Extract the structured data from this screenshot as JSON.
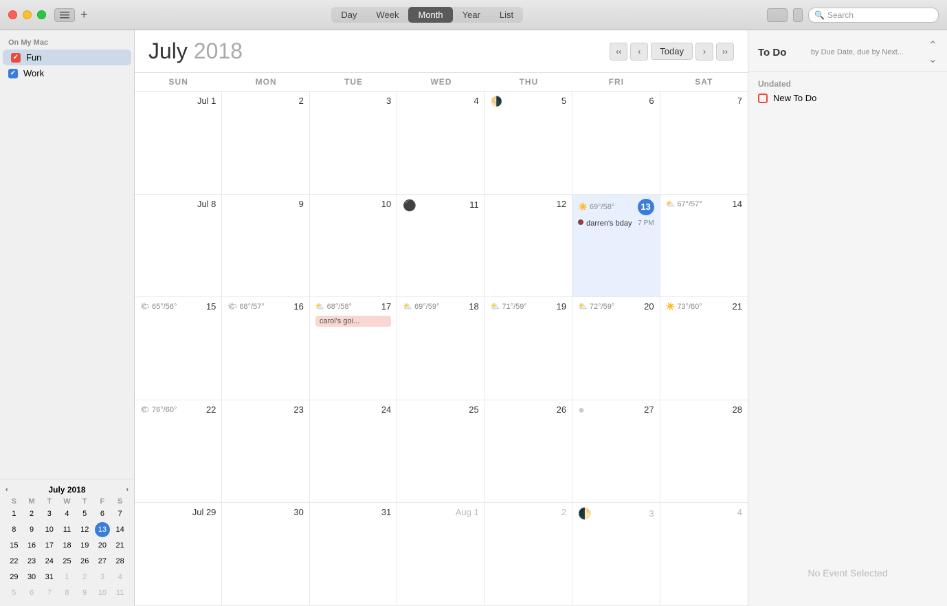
{
  "titlebar": {
    "view_tabs": [
      "Day",
      "Week",
      "Month",
      "Year",
      "List"
    ],
    "active_tab": "Month",
    "search_placeholder": "Search"
  },
  "sidebar": {
    "section_label": "On My Mac",
    "calendars": [
      {
        "name": "Fun",
        "color": "red",
        "checked": true
      },
      {
        "name": "Work",
        "color": "blue",
        "checked": true
      }
    ]
  },
  "mini_cal": {
    "title": "July 2018",
    "day_headers": [
      "S",
      "M",
      "T",
      "W",
      "T",
      "F",
      "S"
    ],
    "weeks": [
      [
        {
          "d": "1",
          "cur": true
        },
        {
          "d": "2",
          "cur": true
        },
        {
          "d": "3",
          "cur": true
        },
        {
          "d": "4",
          "cur": true
        },
        {
          "d": "5",
          "cur": true
        },
        {
          "d": "6",
          "cur": true
        },
        {
          "d": "7",
          "cur": true
        }
      ],
      [
        {
          "d": "8",
          "cur": true
        },
        {
          "d": "9",
          "cur": true
        },
        {
          "d": "10",
          "cur": true
        },
        {
          "d": "11",
          "cur": true
        },
        {
          "d": "12",
          "cur": true
        },
        {
          "d": "13",
          "cur": true,
          "today": true
        },
        {
          "d": "14",
          "cur": true
        }
      ],
      [
        {
          "d": "15",
          "cur": true
        },
        {
          "d": "16",
          "cur": true
        },
        {
          "d": "17",
          "cur": true
        },
        {
          "d": "18",
          "cur": true
        },
        {
          "d": "19",
          "cur": true
        },
        {
          "d": "20",
          "cur": true
        },
        {
          "d": "21",
          "cur": true
        }
      ],
      [
        {
          "d": "22",
          "cur": true
        },
        {
          "d": "23",
          "cur": true
        },
        {
          "d": "24",
          "cur": true
        },
        {
          "d": "25",
          "cur": true
        },
        {
          "d": "26",
          "cur": true
        },
        {
          "d": "27",
          "cur": true
        },
        {
          "d": "28",
          "cur": true
        }
      ],
      [
        {
          "d": "29",
          "cur": true
        },
        {
          "d": "30",
          "cur": true
        },
        {
          "d": "31",
          "cur": true
        },
        {
          "d": "1",
          "cur": false
        },
        {
          "d": "2",
          "cur": false
        },
        {
          "d": "3",
          "cur": false
        },
        {
          "d": "4",
          "cur": false
        }
      ],
      [
        {
          "d": "5",
          "cur": false
        },
        {
          "d": "6",
          "cur": false
        },
        {
          "d": "7",
          "cur": false
        },
        {
          "d": "8",
          "cur": false
        },
        {
          "d": "9",
          "cur": false
        },
        {
          "d": "10",
          "cur": false
        },
        {
          "d": "11",
          "cur": false
        }
      ]
    ]
  },
  "calendar": {
    "title_month": "July",
    "title_year": "2018",
    "day_headers": [
      "SUN",
      "MON",
      "TUE",
      "WED",
      "THU",
      "FRI",
      "SAT"
    ],
    "weeks": [
      {
        "cells": [
          {
            "day": "Jul 1",
            "other": false,
            "weather": null,
            "moon": null,
            "events": []
          },
          {
            "day": "2",
            "other": false,
            "weather": null,
            "moon": null,
            "events": []
          },
          {
            "day": "3",
            "other": false,
            "weather": null,
            "moon": null,
            "events": []
          },
          {
            "day": "4",
            "other": false,
            "weather": null,
            "moon": null,
            "events": []
          },
          {
            "day": "5",
            "other": false,
            "weather": null,
            "moon": "🌗",
            "events": []
          },
          {
            "day": "6",
            "other": false,
            "weather": null,
            "moon": null,
            "events": []
          },
          {
            "day": "7",
            "other": false,
            "weather": null,
            "moon": null,
            "events": []
          }
        ]
      },
      {
        "cells": [
          {
            "day": "Jul 8",
            "other": false,
            "weather": null,
            "moon": null,
            "events": []
          },
          {
            "day": "9",
            "other": false,
            "weather": null,
            "moon": null,
            "events": []
          },
          {
            "day": "10",
            "other": false,
            "weather": null,
            "moon": null,
            "events": []
          },
          {
            "day": "11",
            "other": false,
            "weather": null,
            "moon": null,
            "events": []
          },
          {
            "day": "12",
            "other": false,
            "weather": null,
            "moon": "⚫",
            "events": []
          },
          {
            "day": "13",
            "today": true,
            "other": false,
            "weather": "☀️ 69°/58°",
            "moon": null,
            "events": [
              {
                "type": "event",
                "text": "darren's bday",
                "time": "7 PM",
                "dot": true
              }
            ]
          },
          {
            "day": "14",
            "other": false,
            "weather": "⛅ 67°/57°",
            "moon": null,
            "events": []
          }
        ]
      },
      {
        "cells": [
          {
            "day": "15",
            "other": false,
            "weather": "🌤 65°/56°",
            "moon": null,
            "events": []
          },
          {
            "day": "16",
            "other": false,
            "weather": "🌤 68°/57°",
            "moon": null,
            "events": []
          },
          {
            "day": "17",
            "other": false,
            "weather": "⛅ 68°/58°",
            "moon": null,
            "events": [
              {
                "type": "pill",
                "text": "carol's goi..."
              }
            ]
          },
          {
            "day": "18",
            "other": false,
            "weather": "⛅ 69°/59°",
            "moon": null,
            "events": []
          },
          {
            "day": "19",
            "other": false,
            "weather": "⛅ 71°/59°",
            "moon": null,
            "events": []
          },
          {
            "day": "20",
            "other": false,
            "weather": "⛅ 72°/59°",
            "moon": null,
            "events": []
          },
          {
            "day": "21",
            "other": false,
            "weather": "☀️ 73°/60°",
            "moon": null,
            "events": []
          }
        ]
      },
      {
        "cells": [
          {
            "day": "22",
            "other": false,
            "weather": "🌤 76°/60°",
            "moon": null,
            "events": []
          },
          {
            "day": "23",
            "other": false,
            "weather": null,
            "moon": null,
            "events": []
          },
          {
            "day": "24",
            "other": false,
            "weather": null,
            "moon": null,
            "events": []
          },
          {
            "day": "25",
            "other": false,
            "weather": null,
            "moon": null,
            "events": []
          },
          {
            "day": "26",
            "other": false,
            "weather": null,
            "moon": null,
            "events": []
          },
          {
            "day": "27",
            "other": false,
            "weather": null,
            "moon": "🌑",
            "events": []
          },
          {
            "day": "28",
            "other": false,
            "weather": null,
            "moon": null,
            "events": []
          }
        ]
      },
      {
        "cells": [
          {
            "day": "Jul 29",
            "other": false,
            "weather": null,
            "moon": null,
            "events": []
          },
          {
            "day": "30",
            "other": false,
            "weather": null,
            "moon": null,
            "events": []
          },
          {
            "day": "31",
            "other": false,
            "weather": null,
            "moon": null,
            "events": []
          },
          {
            "day": "Aug 1",
            "other": true,
            "weather": null,
            "moon": null,
            "events": []
          },
          {
            "day": "2",
            "other": true,
            "weather": null,
            "moon": null,
            "events": []
          },
          {
            "day": "3",
            "other": true,
            "weather": null,
            "moon": "🌗",
            "events": []
          },
          {
            "day": "4",
            "other": true,
            "weather": null,
            "moon": null,
            "events": []
          }
        ]
      }
    ]
  },
  "todo": {
    "title": "To Do",
    "sort_label": "by Due Date, due by Next...",
    "section_undated": "Undated",
    "items": [
      {
        "label": "New To Do",
        "color": "red"
      }
    ],
    "no_event": "No Event Selected"
  }
}
